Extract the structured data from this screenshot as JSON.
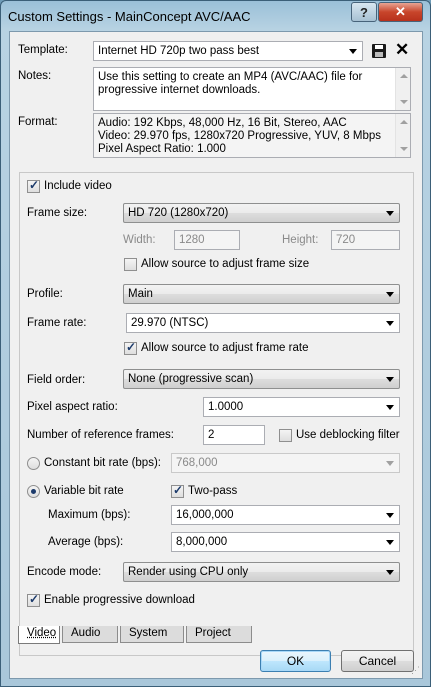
{
  "window": {
    "title": "Custom Settings - MainConcept AVC/AAC",
    "help_label": "?",
    "close_label": "✕"
  },
  "template": {
    "label": "Template:",
    "value": "Internet HD 720p two pass best"
  },
  "notes": {
    "label": "Notes:",
    "lines": [
      "Use this setting to create an MP4 (AVC/AAC) file for",
      "progressive internet downloads."
    ]
  },
  "format": {
    "label": "Format:",
    "lines": [
      "Audio: 192 Kbps, 48,000 Hz, 16 Bit, Stereo, AAC",
      "Video: 29.970 fps, 1280x720 Progressive, YUV, 8 Mbps",
      "Pixel Aspect Ratio: 1.000"
    ]
  },
  "video": {
    "include_video": "Include video",
    "frame_size_label": "Frame size:",
    "frame_size_value": "HD 720 (1280x720)",
    "width_label": "Width:",
    "width_value": "1280",
    "height_label": "Height:",
    "height_value": "720",
    "allow_frame_size": "Allow source to adjust frame size",
    "profile_label": "Profile:",
    "profile_value": "Main",
    "frame_rate_label": "Frame rate:",
    "frame_rate_value": "29.970 (NTSC)",
    "allow_frame_rate": "Allow source to adjust frame rate",
    "field_order_label": "Field order:",
    "field_order_value": "None (progressive scan)",
    "par_label": "Pixel aspect ratio:",
    "par_value": "1.0000",
    "ref_frames_label": "Number of reference frames:",
    "ref_frames_value": "2",
    "deblocking": "Use deblocking filter",
    "cbr_label": "Constant bit rate (bps):",
    "cbr_value": "768,000",
    "vbr_label": "Variable bit rate",
    "two_pass": "Two-pass",
    "max_label": "Maximum (bps):",
    "max_value": "16,000,000",
    "avg_label": "Average (bps):",
    "avg_value": "8,000,000",
    "encode_mode_label": "Encode mode:",
    "encode_mode_value": "Render using CPU only",
    "progressive_download": "Enable progressive download"
  },
  "tabs": [
    "Video",
    "Audio",
    "System",
    "Project"
  ],
  "buttons": {
    "ok": "OK",
    "cancel": "Cancel"
  }
}
